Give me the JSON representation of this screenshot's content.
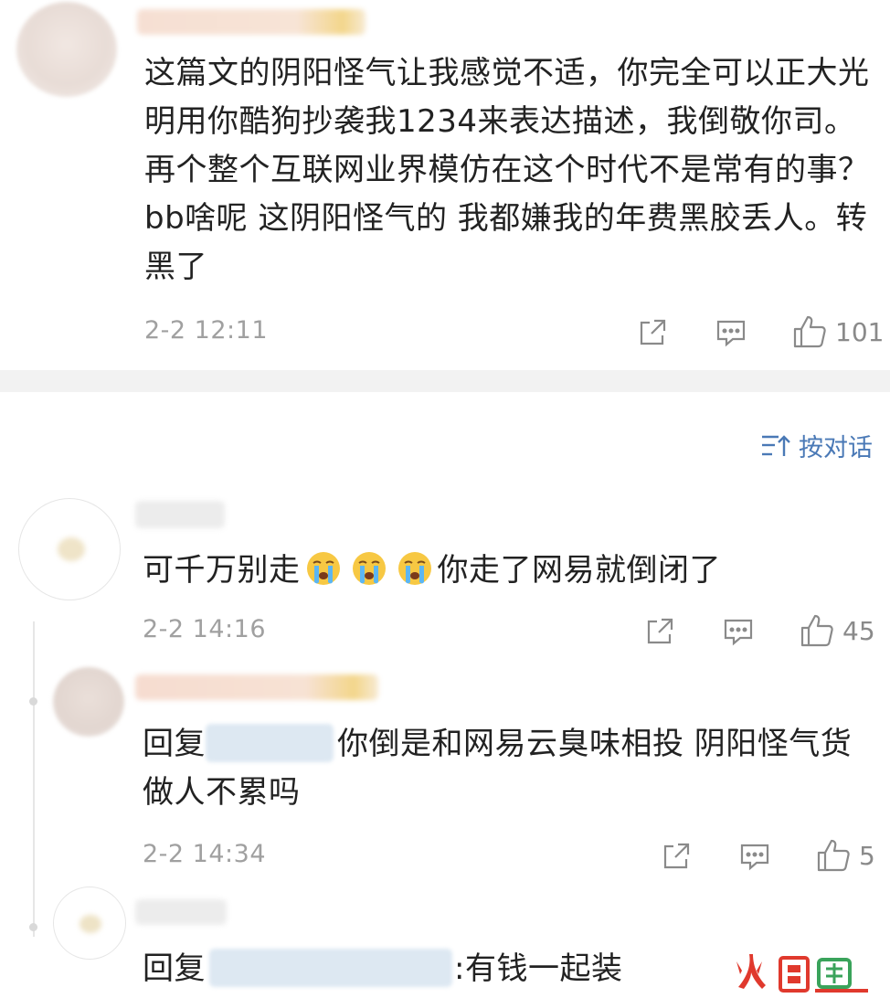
{
  "comments": [
    {
      "text": "这篇文的阴阳怪气让我感觉不适，你完全可以正大光明用你酷狗抄袭我1234来表达描述，我倒敬你司。再个整个互联网业界模仿在这个时代不是常有的事？ bb啥呢 这阴阳怪气的 我都嫌我的年费黑胶丢人。转黑了",
      "time": "2-2 12:11",
      "likes": "101"
    }
  ],
  "sort_toggle": {
    "label": "按对话",
    "icon": "sort-icon"
  },
  "thread": {
    "root": {
      "text_before": "可千万别走",
      "emojis": [
        "crying-face-emoji",
        "crying-face-emoji",
        "crying-face-emoji"
      ],
      "text_after": "你走了网易就倒闭了",
      "time": "2-2 14:16",
      "likes": "45"
    },
    "replies": [
      {
        "reply_prefix": "回复",
        "text": "你倒是和网易云臭味相投 阴阳怪气货 做人不累吗",
        "time": "2-2 14:34",
        "likes": "5"
      },
      {
        "reply_prefix": "回复",
        "text": ":有钱一起装"
      }
    ]
  },
  "icons": {
    "share": "share-icon",
    "comment": "comment-icon",
    "like": "thumbs-up-icon"
  },
  "colors": {
    "text": "#222222",
    "meta": "#a0a0a0",
    "link": "#4a79b6",
    "divider": "#f2f2f2",
    "watermark": "#e0392d"
  }
}
